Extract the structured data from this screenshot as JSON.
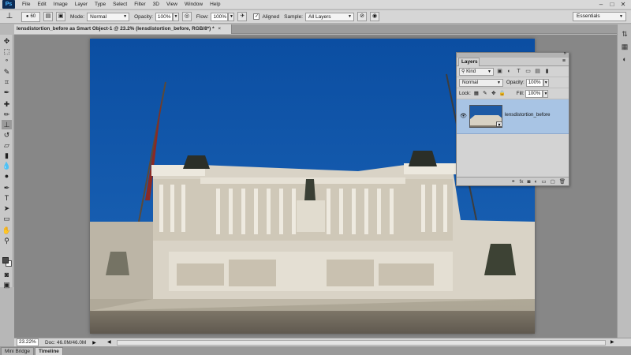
{
  "menubar": {
    "logo": "Ps",
    "items": [
      "File",
      "Edit",
      "Image",
      "Layer",
      "Type",
      "Select",
      "Filter",
      "3D",
      "View",
      "Window",
      "Help"
    ],
    "window_controls": [
      "–",
      "□",
      "✕"
    ]
  },
  "options": {
    "brush_size": "60",
    "mode_label": "Mode:",
    "mode_value": "Normal",
    "opacity_label": "Opacity:",
    "opacity_value": "100%",
    "flow_label": "Flow:",
    "flow_value": "100%",
    "aligned_label": "Aligned",
    "aligned_checked": true,
    "sample_label": "Sample:",
    "sample_value": "All Layers",
    "workspace": "Essentials"
  },
  "document": {
    "tab_title": "lensdistortion_before as Smart Object-1 @ 23.2% (lensdistortion_before, RGB/8*) *",
    "tab_close": "×"
  },
  "layers_panel": {
    "title": "Layers",
    "filter_kind": "Kind",
    "blend_mode": "Normal",
    "opacity_label": "Opacity:",
    "opacity_value": "100%",
    "lock_label": "Lock:",
    "fill_label": "Fill:",
    "fill_value": "100%",
    "layers": [
      {
        "name": "lensdistortion_before",
        "visible": true,
        "selected": true,
        "smart_object": true
      }
    ]
  },
  "statusbar": {
    "zoom": "23.22%",
    "doc_info": "Doc: 46.0M/46.0M"
  },
  "bottom_tabs": [
    "Mini Bridge",
    "Timeline"
  ],
  "colors": {
    "sky": "#12539d",
    "layer_selected": "#a8c4e4",
    "canvas_bg": "#878787",
    "ps_logo_bg": "#0d2b54",
    "ps_logo_text": "#49b6ff"
  },
  "icons": {
    "toolbox": [
      "move-icon",
      "marquee-icon",
      "lasso-icon",
      "quick-select-icon",
      "crop-icon",
      "eyedropper-icon",
      "healing-brush-icon",
      "brush-icon",
      "clone-stamp-icon",
      "history-brush-icon",
      "eraser-icon",
      "gradient-icon",
      "blur-icon",
      "dodge-icon",
      "pen-icon",
      "type-icon",
      "path-select-icon",
      "shape-icon",
      "hand-icon",
      "zoom-icon"
    ]
  }
}
